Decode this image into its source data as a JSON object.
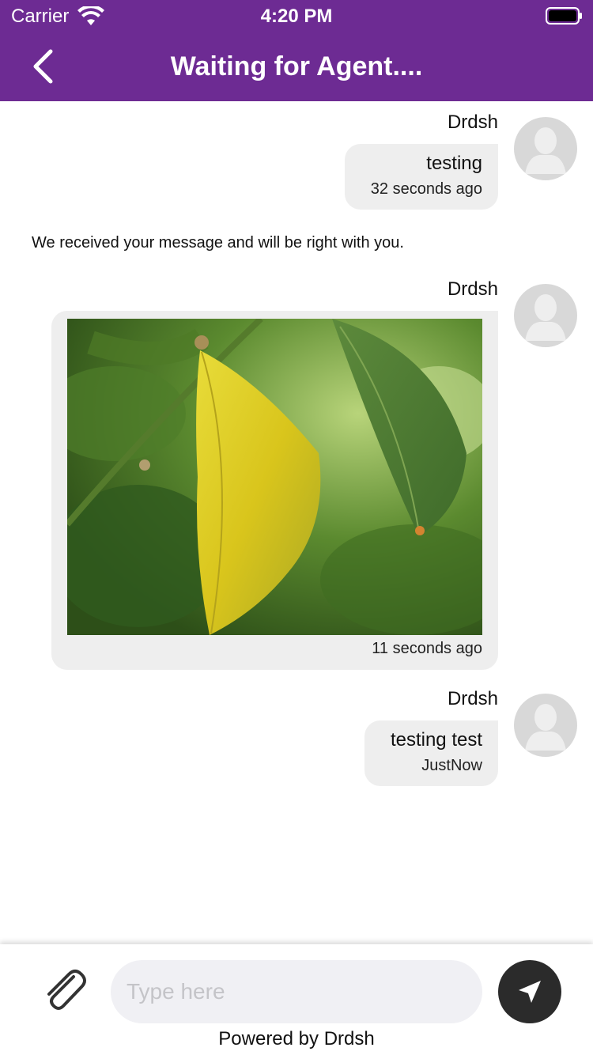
{
  "status_bar": {
    "carrier": "Carrier",
    "time": "4:20 PM"
  },
  "header": {
    "title": "Waiting for Agent....",
    "background_color": "#6d2b93",
    "back_icon": "chevron-left-icon"
  },
  "messages": [
    {
      "sender": "Drdsh",
      "text": "testing",
      "time": "32 seconds ago"
    },
    {
      "system_text": "We received your message and will be right with you."
    },
    {
      "sender": "Drdsh",
      "image": "leaf-photo",
      "time": "11 seconds ago"
    },
    {
      "sender": "Drdsh",
      "text": "testing test",
      "time": "JustNow"
    }
  ],
  "composer": {
    "placeholder": "Type here",
    "attach_icon": "paperclip-icon",
    "send_icon": "send-icon"
  },
  "footer": {
    "powered_by": "Powered by Drdsh"
  }
}
